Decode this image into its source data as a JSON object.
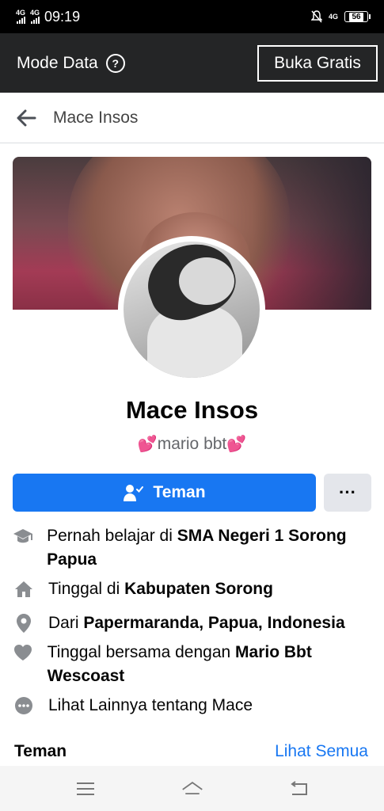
{
  "status_bar": {
    "network1": "4G",
    "network2": "4G",
    "time": "09:19",
    "network3": "4G",
    "battery": "56"
  },
  "mode_bar": {
    "label": "Mode Data",
    "help": "?",
    "button": "Buka Gratis"
  },
  "header": {
    "title": "Mace Insos"
  },
  "profile": {
    "name": "Mace Insos",
    "nickname_heart_left": "💕",
    "nickname": "mario bbt",
    "nickname_heart_right": "💕"
  },
  "actions": {
    "friend_label": "Teman",
    "more_label": "···"
  },
  "info": [
    {
      "icon": "graduation-cap-icon",
      "prefix": "Pernah belajar di ",
      "bold": "SMA Negeri 1 Sorong Papua"
    },
    {
      "icon": "home-icon",
      "prefix": "Tinggal di ",
      "bold": "Kabupaten Sorong"
    },
    {
      "icon": "location-pin-icon",
      "prefix": "Dari ",
      "bold": "Papermaranda, Papua, Indonesia"
    },
    {
      "icon": "heart-icon",
      "prefix": "Tinggal bersama dengan ",
      "bold": "Mario Bbt Wescoast"
    },
    {
      "icon": "more-dots-icon",
      "prefix": "Lihat Lainnya tentang Mace",
      "bold": ""
    }
  ],
  "friends": {
    "title": "Teman",
    "see_all": "Lihat Semua"
  },
  "colors": {
    "accent": "#1877f2",
    "icon_gray": "#8a8d91"
  }
}
